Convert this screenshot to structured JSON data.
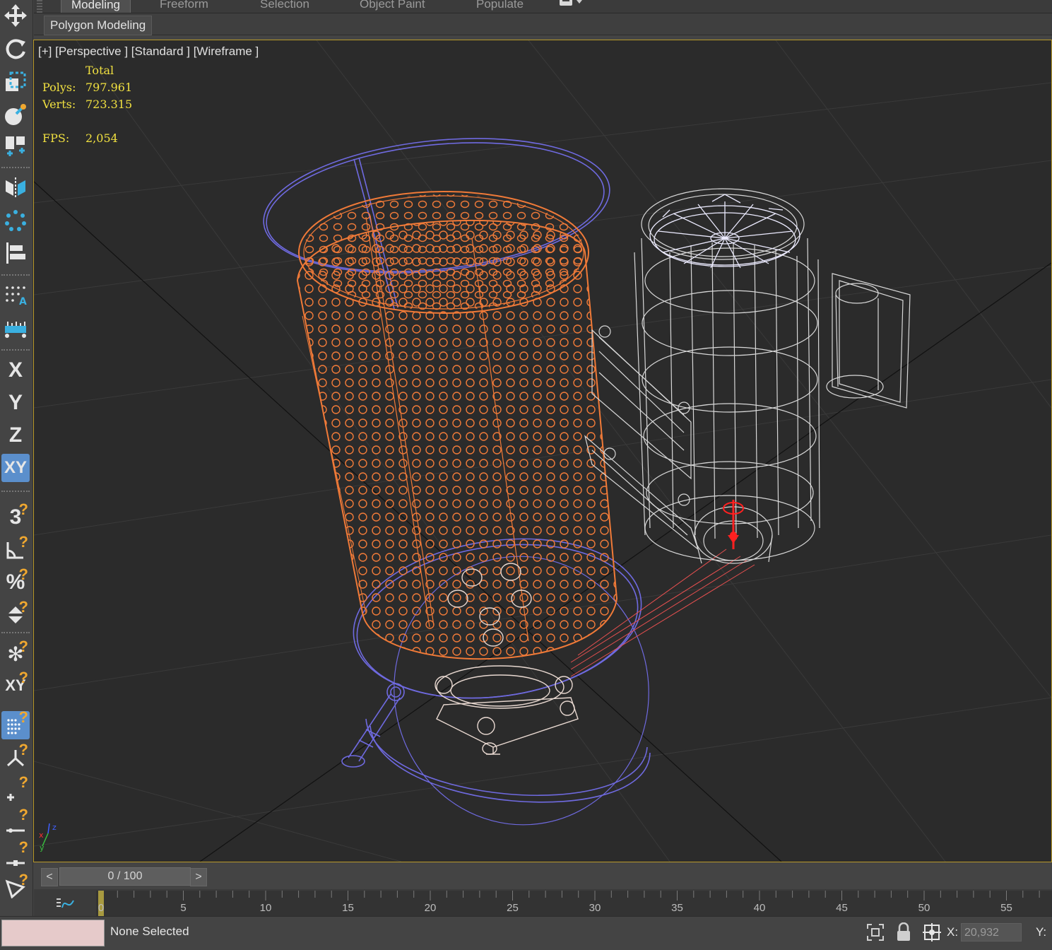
{
  "ribbon": {
    "tabs": [
      "Modeling",
      "Freeform",
      "Selection",
      "Object Paint",
      "Populate"
    ],
    "active_tab": "Modeling",
    "panel_label": "Polygon Modeling"
  },
  "toolbar": {
    "axis_x": "X",
    "axis_y": "Y",
    "axis_z": "Z",
    "axis_xy": "XY",
    "snap_3d": "3",
    "percent": "%",
    "xy_small": "XY"
  },
  "viewport": {
    "label": "[+] [Perspective ] [Standard ] [Wireframe ]",
    "stats": {
      "header": "Total",
      "polys_label": "Polys:",
      "polys_value": "797.961",
      "verts_label": "Verts:",
      "verts_value": "723.315",
      "fps_label": "FPS:",
      "fps_value": "2,054"
    },
    "colors": {
      "selected": "#f07a38",
      "blue": "#6f6ae0",
      "white": "#e8e8e8",
      "gizmo": "#ff2020",
      "border": "#b99a2a"
    }
  },
  "timeline": {
    "prev": "<",
    "next": ">",
    "frame": "0 / 100",
    "ticks": [
      "0",
      "5",
      "10",
      "15",
      "20",
      "25",
      "30",
      "35",
      "40",
      "45",
      "50",
      "55"
    ]
  },
  "status": {
    "selection": "None Selected",
    "x_label": "X:",
    "x_value": "20,932",
    "y_label": "Y:"
  }
}
